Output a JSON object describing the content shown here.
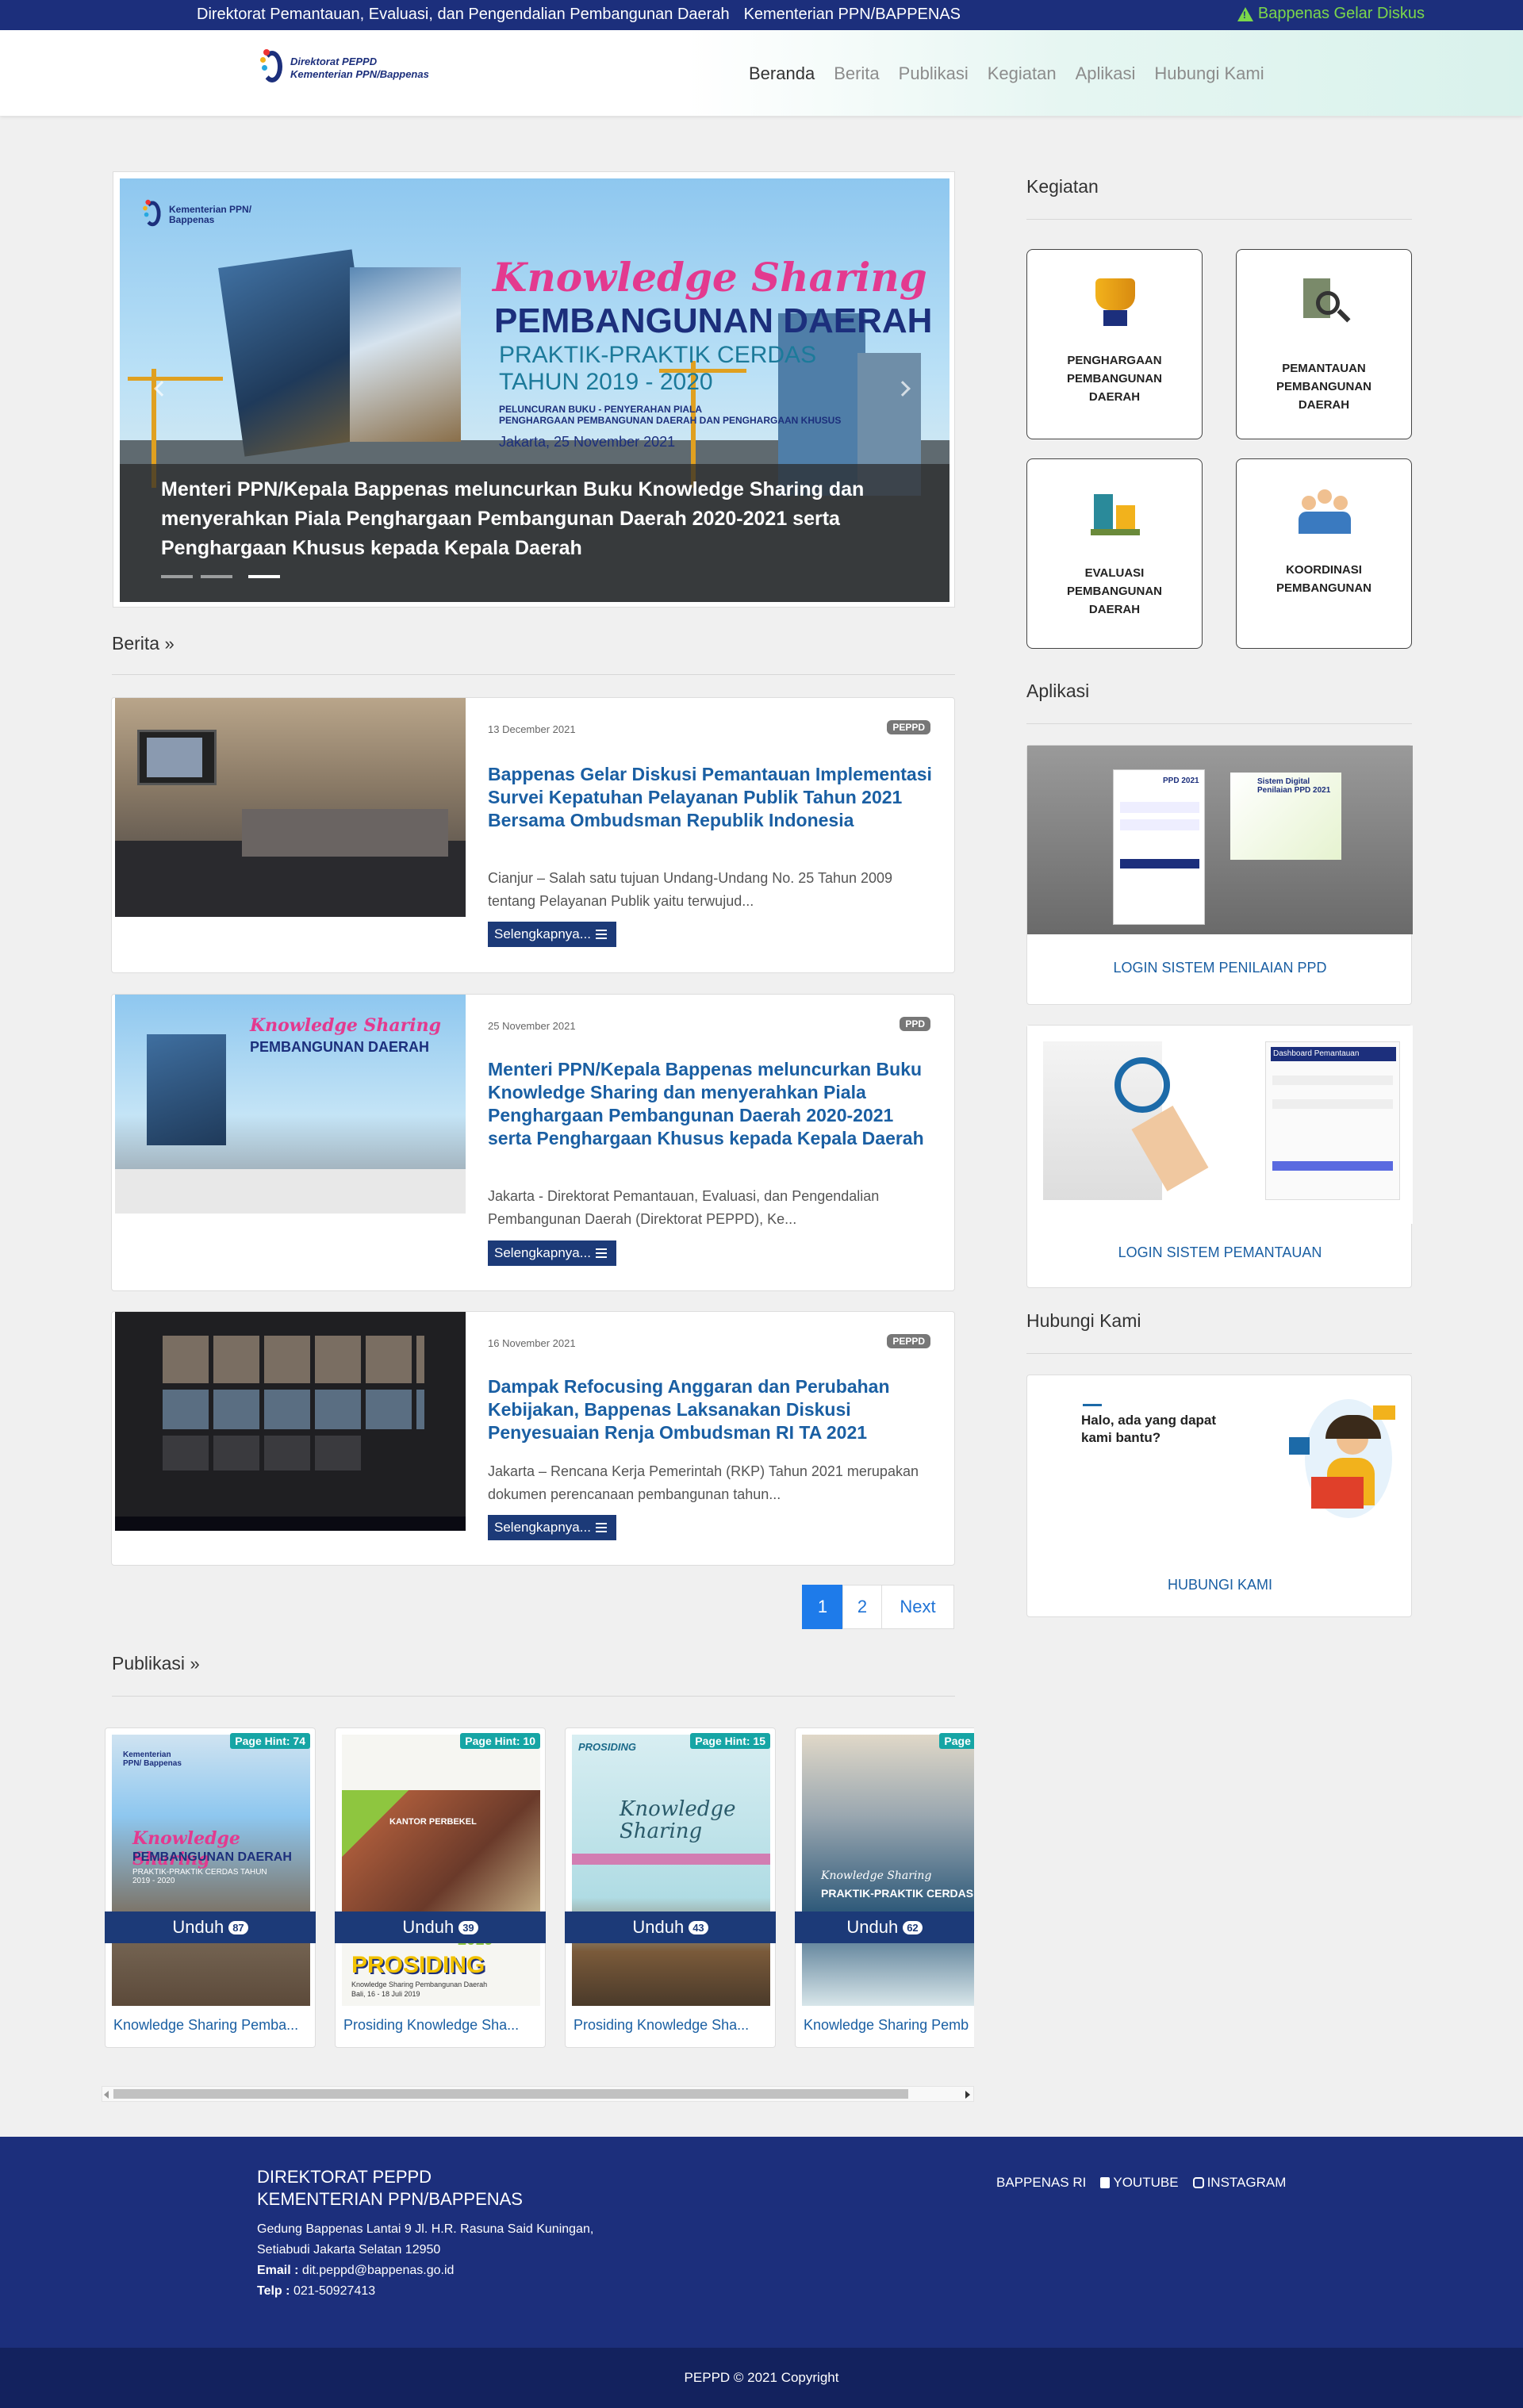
{
  "topbar": {
    "org": "Direktorat Pemantauan, Evaluasi, dan Pengendalian Pembangunan Daerah",
    "ministry": "Kementerian PPN/BAPPENAS",
    "alert": "Bappenas Gelar Diskus"
  },
  "nav": {
    "logo_line1": "Direktorat PEPPD",
    "logo_line2": "Kementerian PPN/Bappenas",
    "items": [
      "Beranda",
      "Berita",
      "Publikasi",
      "Kegiatan",
      "Aplikasi",
      "Hubungi Kami"
    ]
  },
  "carousel": {
    "brand1": "Kementerian PPN/",
    "brand2": "Bappenas",
    "title1": "Knowledge Sharing",
    "title2": "PEMBANGUNAN DAERAH",
    "title3": "PRAKTIK-PRAKTIK CERDAS",
    "title4": "TAHUN 2019 - 2020",
    "small1": "PELUNCURAN BUKU - PENYERAHAN PIALA",
    "small2": "PENGHARGAAN PEMBANGUNAN DAERAH DAN PENGHARGAAN KHUSUS",
    "date": "Jakarta, 25 November 2021",
    "caption": "Menteri PPN/Kepala Bappenas meluncurkan Buku Knowledge Sharing dan menyerahkan Piala Penghargaan Pembangunan Daerah 2020-2021 serta Penghargaan Khusus kepada Kepala Daerah"
  },
  "berita": {
    "heading": "Berita",
    "more_label": "Selengkapnya...",
    "items": [
      {
        "date": "13 December 2021",
        "badge": "PEPPD",
        "title": "Bappenas Gelar Diskusi Pemantauan Implementasi Survei Kepatuhan Pelayanan Publik Tahun 2021 Bersama Ombudsman Republik Indonesia",
        "excerpt": "Cianjur – Salah satu tujuan Undang-Undang No. 25 Tahun 2009 tentang Pelayanan Publik yaitu terwujud..."
      },
      {
        "date": "25 November 2021",
        "badge": "PPD",
        "title": "Menteri PPN/Kepala Bappenas meluncurkan Buku Knowledge Sharing dan menyerahkan Piala Penghargaan Pembangunan Daerah 2020-2021 serta Penghargaan Khusus kepada Kepala Daerah",
        "excerpt": "Jakarta - Direktorat Pemantauan, Evaluasi, dan Pengendalian Pembangunan Daerah (Direktorat PEPPD), Ke..."
      },
      {
        "date": "16 November 2021",
        "badge": "PEPPD",
        "title": "Dampak Refocusing Anggaran dan Perubahan Kebijakan, Bappenas Laksanakan Diskusi Penyesuaian Renja Ombudsman RI TA 2021",
        "excerpt": "Jakarta – Rencana Kerja Pemerintah (RKP) Tahun 2021 merupakan dokumen perencanaan pembangunan tahun..."
      }
    ]
  },
  "pagination": {
    "pages": [
      "1",
      "2"
    ],
    "next": "Next",
    "current": "1"
  },
  "publikasi": {
    "heading": "Publikasi",
    "download_label": "Unduh",
    "items": [
      {
        "title": "Knowledge Sharing Pemba...",
        "hint": "Page Hint: 74",
        "downloads": "87"
      },
      {
        "title": "Prosiding Knowledge Sha...",
        "hint": "Page Hint: 10",
        "downloads": "39"
      },
      {
        "title": "Prosiding Knowledge Sha...",
        "hint": "Page Hint: 15",
        "downloads": "43"
      },
      {
        "title": "Knowledge Sharing Pemb",
        "hint": "Page Hint",
        "downloads": "62"
      }
    ],
    "cover_texts": {
      "c1_brand": "Kementerian PPN/ Bappenas",
      "c1_title": "Knowledge Sharing",
      "c1_sub": "PEMBANGUNAN DAERAH",
      "c1_sub2": "PRAKTIK-PRAKTIK CERDAS TAHUN 2019 - 2020",
      "c2_year": "2019",
      "c2_title": "PROSIDING",
      "c2_sub": "Knowledge Sharing Pembangunan Daerah",
      "c2_place": "Bali, 16 - 18 Juli 2019",
      "c2_sign": "KANTOR PERBEKEL",
      "c3_top": "PROSIDING",
      "c3_title": "Knowledge Sharing",
      "c4_title": "Knowledge Sharing",
      "c4_sub": "PRAKTIK-PRAKTIK CERDAS"
    }
  },
  "sidebar": {
    "kegiatan_heading": "Kegiatan",
    "kegiatan": [
      {
        "label": "PENGHARGAAN PEMBANGUNAN DAERAH",
        "icon": "trophy-icon"
      },
      {
        "label": "PEMANTAUAN PEMBANGUNAN DAERAH",
        "icon": "magnifier-icon"
      },
      {
        "label": "EVALUASI PEMBANGUNAN DAERAH",
        "icon": "building-chart-icon"
      },
      {
        "label": "KOORDINASI PEMBANGUNAN",
        "icon": "team-icon"
      }
    ],
    "aplikasi_heading": "Aplikasi",
    "apps": [
      {
        "label": "LOGIN SISTEM PENILAIAN PPD",
        "screen_title": "Sistem Digital Penilaian PPD 2021",
        "screen_brand": "PPD 2021"
      },
      {
        "label": "LOGIN SISTEM PEMANTAUAN",
        "screen_title": "Dashboard Pemantauan"
      }
    ],
    "kontak_heading": "Hubungi Kami",
    "kontak_prompt": "Halo, ada yang dapat kami bantu?",
    "kontak_label": "HUBUNGI KAMI"
  },
  "footer": {
    "org1": "DIREKTORAT PEPPD",
    "org2": "KEMENTERIAN PPN/BAPPENAS",
    "address1": "Gedung Bappenas Lantai 9 Jl. H.R. Rasuna Said Kuningan,",
    "address2": "Setiabudi Jakarta Selatan 12950",
    "email_label": "Email :",
    "email": "dit.peppd@bappenas.go.id",
    "phone_label": "Telp :",
    "phone": "021-50927413",
    "links": [
      "BAPPENAS RI",
      "YOUTUBE",
      "INSTAGRAM"
    ],
    "copyright": "PEPPD © 2021 Copyright"
  },
  "colors": {
    "navy": "#1c2f7c",
    "button": "#1c3a78",
    "link": "#1a5fa3",
    "alert": "#7cd84a",
    "pager_active": "#1e7bea"
  }
}
